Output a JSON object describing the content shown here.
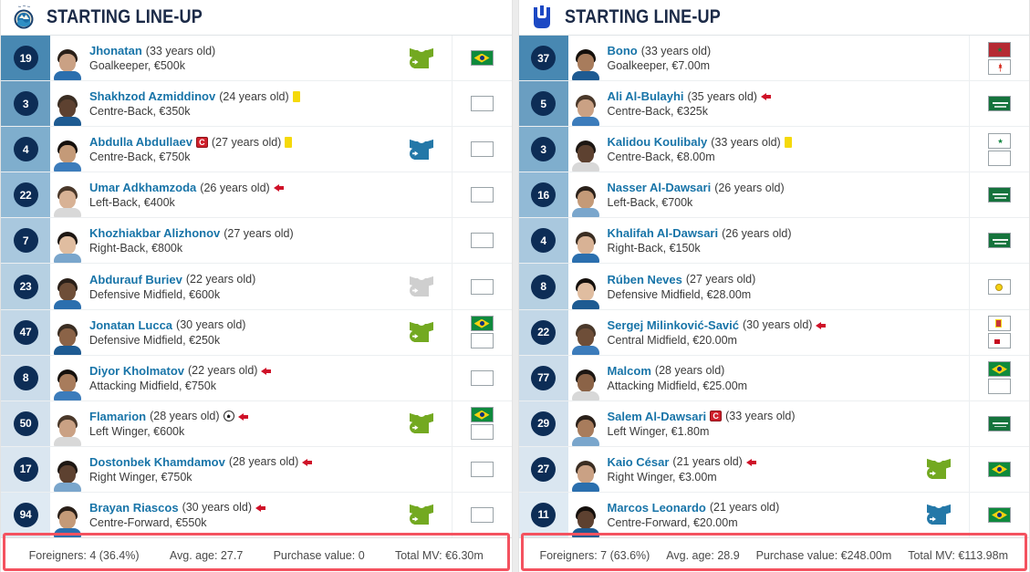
{
  "accent": {
    "name_link": "#1874a8",
    "badge_navy": "#0d2d56",
    "title_navy": "#1b2a47",
    "sub_in_green": "#73a921",
    "sub_off_blue": "#2478a8",
    "sub_unused_gray": "#cfcfcf",
    "card_yellow": "#f5d90a",
    "arrow_red": "#cf1128",
    "highlight_red": "#f4525f"
  },
  "panels": [
    {
      "id": "home",
      "title": "STARTING LINE-UP",
      "logo": "pakhtakor-crest-icon",
      "players": [
        {
          "number": "19",
          "name": "Jhonatan",
          "age": "(33 years old)",
          "detail": "Goalkeeper, €500k",
          "captain": false,
          "yellow": false,
          "goal": false,
          "subbed_off": false,
          "sub_icon": "sub-in",
          "flags": [
            "brazil"
          ]
        },
        {
          "number": "3",
          "name": "Shakhzod Azmiddinov",
          "age": "(24 years old)",
          "detail": "Centre-Back, €350k",
          "captain": false,
          "yellow": true,
          "goal": false,
          "subbed_off": false,
          "sub_icon": "none",
          "flags": [
            "uzbekistan"
          ]
        },
        {
          "number": "4",
          "name": "Abdulla Abdullaev",
          "age": "(27 years old)",
          "detail": "Centre-Back, €750k",
          "captain": true,
          "yellow": true,
          "goal": false,
          "subbed_off": false,
          "sub_icon": "sub-off",
          "flags": [
            "uzbekistan"
          ]
        },
        {
          "number": "22",
          "name": "Umar Adkhamzoda",
          "age": "(26 years old)",
          "detail": "Left-Back, €400k",
          "captain": false,
          "yellow": false,
          "goal": false,
          "subbed_off": true,
          "sub_icon": "none",
          "flags": [
            "uzbekistan"
          ]
        },
        {
          "number": "7",
          "name": "Khozhiakbar Alizhonov",
          "age": "(27 years old)",
          "detail": "Right-Back, €800k",
          "captain": false,
          "yellow": false,
          "goal": false,
          "subbed_off": false,
          "sub_icon": "none",
          "flags": [
            "uzbekistan"
          ]
        },
        {
          "number": "23",
          "name": "Abdurauf Buriev",
          "age": "(22 years old)",
          "detail": "Defensive Midfield, €600k",
          "captain": false,
          "yellow": false,
          "goal": false,
          "subbed_off": false,
          "sub_icon": "sub-unused",
          "flags": [
            "uzbekistan"
          ]
        },
        {
          "number": "47",
          "name": "Jonatan Lucca",
          "age": "(30 years old)",
          "detail": "Defensive Midfield, €250k",
          "captain": false,
          "yellow": false,
          "goal": false,
          "subbed_off": false,
          "sub_icon": "sub-in",
          "flags": [
            "brazil",
            "italy"
          ]
        },
        {
          "number": "8",
          "name": "Diyor Kholmatov",
          "age": "(22 years old)",
          "detail": "Attacking Midfield, €750k",
          "captain": false,
          "yellow": false,
          "goal": false,
          "subbed_off": true,
          "sub_icon": "none",
          "flags": [
            "uzbekistan"
          ]
        },
        {
          "number": "50",
          "name": "Flamarion",
          "age": "(28 years old)",
          "detail": "Left Winger, €600k",
          "captain": false,
          "yellow": false,
          "goal": true,
          "subbed_off": true,
          "sub_icon": "sub-in",
          "flags": [
            "brazil",
            "georgia"
          ]
        },
        {
          "number": "17",
          "name": "Dostonbek Khamdamov",
          "age": "(28 years old)",
          "detail": "Right Winger, €750k",
          "captain": false,
          "yellow": false,
          "goal": false,
          "subbed_off": true,
          "sub_icon": "none",
          "flags": [
            "uzbekistan"
          ]
        },
        {
          "number": "94",
          "name": "Brayan Riascos",
          "age": "(30 years old)",
          "detail": "Centre-Forward, €550k",
          "captain": false,
          "yellow": false,
          "goal": false,
          "subbed_off": true,
          "sub_icon": "sub-in",
          "flags": [
            "colombia"
          ]
        }
      ],
      "summary": {
        "foreigners": "Foreigners: 4 (36.4%)",
        "avg_age": "Avg. age: 27.7",
        "purchase_value": "Purchase value: 0",
        "total_mv": "Total MV: €6.30m"
      }
    },
    {
      "id": "away",
      "title": "STARTING LINE-UP",
      "logo": "al-hilal-crest-icon",
      "players": [
        {
          "number": "37",
          "name": "Bono",
          "age": "(33 years old)",
          "detail": "Goalkeeper, €7.00m",
          "captain": false,
          "yellow": false,
          "goal": false,
          "subbed_off": false,
          "sub_icon": "none",
          "flags": [
            "morocco",
            "canada"
          ]
        },
        {
          "number": "5",
          "name": "Ali Al-Bulayhi",
          "age": "(35 years old)",
          "detail": "Centre-Back, €325k",
          "captain": false,
          "yellow": false,
          "goal": false,
          "subbed_off": true,
          "sub_icon": "none",
          "flags": [
            "saudi"
          ]
        },
        {
          "number": "3",
          "name": "Kalidou Koulibaly",
          "age": "(33 years old)",
          "detail": "Centre-Back, €8.00m",
          "captain": false,
          "yellow": true,
          "goal": false,
          "subbed_off": false,
          "sub_icon": "none",
          "flags": [
            "senegal",
            "france"
          ]
        },
        {
          "number": "16",
          "name": "Nasser Al-Dawsari",
          "age": "(26 years old)",
          "detail": "Left-Back, €700k",
          "captain": false,
          "yellow": false,
          "goal": false,
          "subbed_off": false,
          "sub_icon": "none",
          "flags": [
            "saudi"
          ]
        },
        {
          "number": "4",
          "name": "Khalifah Al-Dawsari",
          "age": "(26 years old)",
          "detail": "Right-Back, €150k",
          "captain": false,
          "yellow": false,
          "goal": false,
          "subbed_off": false,
          "sub_icon": "none",
          "flags": [
            "saudi"
          ]
        },
        {
          "number": "8",
          "name": "Rúben Neves",
          "age": "(27 years old)",
          "detail": "Defensive Midfield, €28.00m",
          "captain": false,
          "yellow": false,
          "goal": false,
          "subbed_off": false,
          "sub_icon": "none",
          "flags": [
            "portugal"
          ]
        },
        {
          "number": "22",
          "name": "Sergej Milinković-Savić",
          "age": "(30 years old)",
          "detail": "Central Midfield, €20.00m",
          "captain": false,
          "yellow": false,
          "goal": false,
          "subbed_off": true,
          "sub_icon": "none",
          "flags": [
            "serbia",
            "spain"
          ]
        },
        {
          "number": "77",
          "name": "Malcom",
          "age": "(28 years old)",
          "detail": "Attacking Midfield, €25.00m",
          "captain": false,
          "yellow": false,
          "goal": false,
          "subbed_off": false,
          "sub_icon": "none",
          "flags": [
            "brazil",
            "russia"
          ]
        },
        {
          "number": "29",
          "name": "Salem Al-Dawsari",
          "age": "(33 years old)",
          "detail": "Left Winger, €1.80m",
          "captain": true,
          "yellow": false,
          "goal": false,
          "subbed_off": false,
          "sub_icon": "none",
          "flags": [
            "saudi"
          ]
        },
        {
          "number": "27",
          "name": "Kaio César",
          "age": "(21 years old)",
          "detail": "Right Winger, €3.00m",
          "captain": false,
          "yellow": false,
          "goal": false,
          "subbed_off": true,
          "sub_icon": "sub-in",
          "flags": [
            "brazil"
          ]
        },
        {
          "number": "11",
          "name": "Marcos Leonardo",
          "age": "(21 years old)",
          "detail": "Centre-Forward, €20.00m",
          "captain": false,
          "yellow": false,
          "goal": false,
          "subbed_off": false,
          "sub_icon": "sub-off",
          "flags": [
            "brazil"
          ]
        }
      ],
      "summary": {
        "foreigners": "Foreigners: 7 (63.6%)",
        "avg_age": "Avg. age: 28.9",
        "purchase_value": "Purchase value: €248.00m",
        "total_mv": "Total MV: €113.98m"
      }
    }
  ]
}
